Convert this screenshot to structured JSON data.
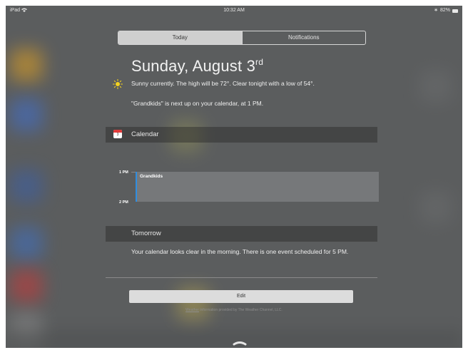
{
  "status_bar": {
    "device": "iPad",
    "time": "10:32 AM",
    "battery": "82%",
    "wifi_icon": "wifi-icon",
    "bluetooth_icon": "bluetooth-icon",
    "battery_icon": "battery-icon"
  },
  "tabs": [
    {
      "label": "Today",
      "selected": true
    },
    {
      "label": "Notifications",
      "selected": false
    }
  ],
  "today": {
    "date_main": "Sunday, August 3",
    "date_suffix": "rd",
    "weather_icon": "sun-icon",
    "weather_summary": "Sunny currently. The high will be 72°. Clear tonight with a low of 54°.",
    "next_event_summary": "\"Grandkids\" is next up on your calendar, at 1 PM."
  },
  "calendar": {
    "header": "Calendar",
    "icon": "calendar-app-icon",
    "times": [
      "1 PM",
      "2 PM"
    ],
    "event": {
      "title": "Grandkids",
      "color": "#2f8ee0"
    }
  },
  "tomorrow": {
    "header": "Tomorrow",
    "text": "Your calendar looks clear in the morning. There is one event scheduled for 5 PM."
  },
  "edit_label": "Edit",
  "credits": {
    "link": "Weather",
    "text": " information provided by The Weather Channel, LLC."
  },
  "colors": {
    "background": "#5b5d5e",
    "accent_event": "#2f8ee0",
    "sun": "#f4d21f"
  }
}
